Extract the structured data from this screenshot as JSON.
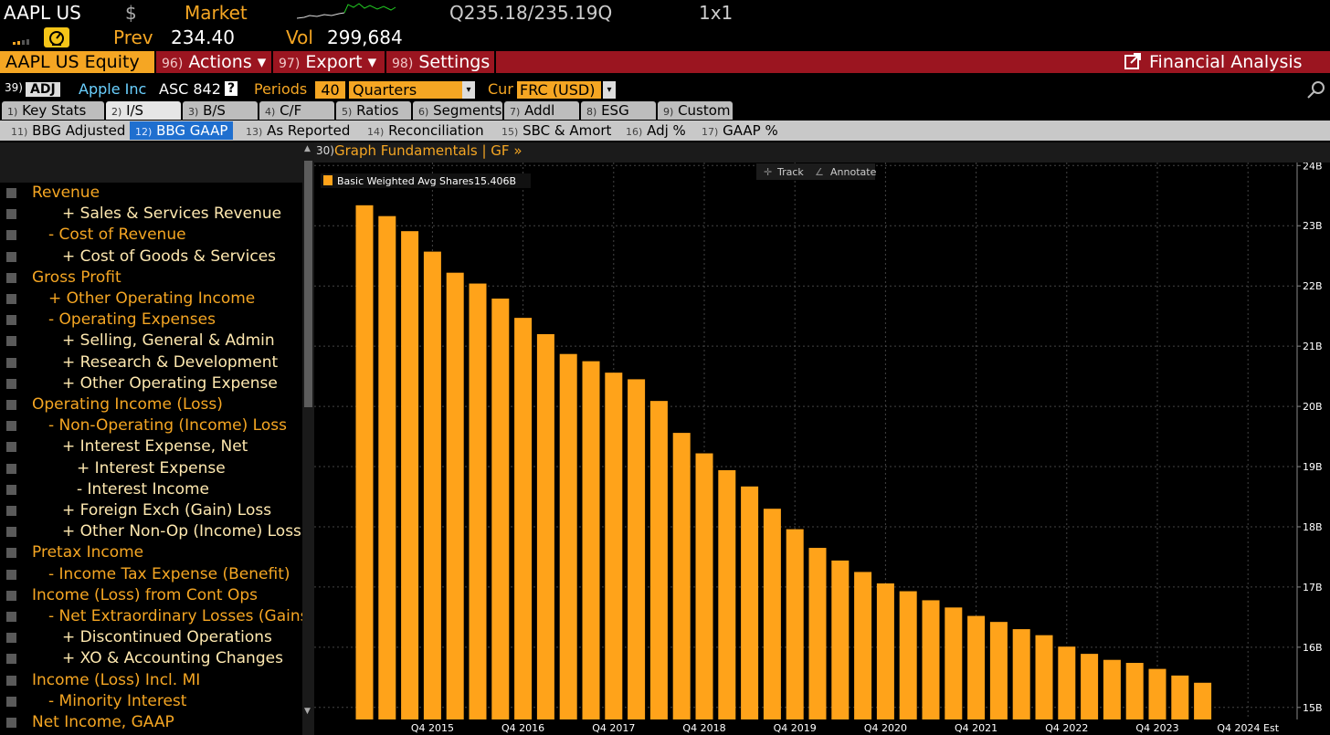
{
  "header": {
    "ticker": "AAPL US",
    "currency_symbol": "$",
    "market_label": "Market",
    "quote": "Q235.18/235.19Q",
    "size": "1x1",
    "prev_label": "Prev",
    "prev_value": "234.40",
    "vol_label": "Vol",
    "vol_value": "299,684"
  },
  "toolbar": {
    "security": "AAPL US Equity",
    "actions": {
      "num": "96)",
      "label": "Actions ▾"
    },
    "export": {
      "num": "97)",
      "label": "Export ▾"
    },
    "settings": {
      "num": "98)",
      "label": "Settings"
    },
    "financial_analysis": "Financial Analysis"
  },
  "controls": {
    "num": "39)",
    "adj": "ADJ",
    "company": "Apple Inc",
    "standard": "ASC 842",
    "help": "?",
    "periods_label": "Periods",
    "periods_value": "40",
    "periods_type": "Quarters",
    "cur_label": "Cur",
    "cur_value": "FRC (USD)"
  },
  "tabs_main": [
    {
      "num": "1)",
      "label": "Key Stats"
    },
    {
      "num": "2)",
      "label": "I/S"
    },
    {
      "num": "3)",
      "label": "B/S"
    },
    {
      "num": "4)",
      "label": "C/F"
    },
    {
      "num": "5)",
      "label": "Ratios"
    },
    {
      "num": "6)",
      "label": "Segments"
    },
    {
      "num": "7)",
      "label": "Addl"
    },
    {
      "num": "8)",
      "label": "ESG"
    },
    {
      "num": "9)",
      "label": "Custom"
    }
  ],
  "tabs_sub": [
    {
      "num": "11)",
      "label": "BBG Adjusted"
    },
    {
      "num": "12)",
      "label": "BBG GAAP"
    },
    {
      "num": "13)",
      "label": "As Reported"
    },
    {
      "num": "14)",
      "label": "Reconciliation"
    },
    {
      "num": "15)",
      "label": "SBC & Amort"
    },
    {
      "num": "16)",
      "label": "Adj %"
    },
    {
      "num": "17)",
      "label": "GAAP %"
    }
  ],
  "graph_bar": {
    "num": "30)",
    "label": "Graph Fundamentals | GF »"
  },
  "chart_tools": {
    "track": "Track",
    "annotate": "Annotate"
  },
  "line_items": [
    {
      "label": "Revenue",
      "level": 0
    },
    {
      "label": "+ Sales & Services Revenue",
      "level": 2
    },
    {
      "label": "- Cost of Revenue",
      "level": 1
    },
    {
      "label": "+ Cost of Goods & Services",
      "level": 2
    },
    {
      "label": "Gross Profit",
      "level": 0
    },
    {
      "label": "+ Other Operating Income",
      "level": 1
    },
    {
      "label": "- Operating Expenses",
      "level": 1
    },
    {
      "label": "+ Selling, General & Admin",
      "level": 2
    },
    {
      "label": "+ Research & Development",
      "level": 2
    },
    {
      "label": "+ Other Operating Expense",
      "level": 2
    },
    {
      "label": "Operating Income (Loss)",
      "level": 0
    },
    {
      "label": "- Non-Operating (Income) Loss",
      "level": 1
    },
    {
      "label": "+ Interest Expense, Net",
      "level": 2
    },
    {
      "label": "+ Interest Expense",
      "level": 3
    },
    {
      "label": "- Interest Income",
      "level": 3
    },
    {
      "label": "+ Foreign Exch (Gain) Loss",
      "level": 2
    },
    {
      "label": "+ Other Non-Op (Income) Loss",
      "level": 2
    },
    {
      "label": "Pretax Income",
      "level": 0
    },
    {
      "label": "- Income Tax Expense (Benefit)",
      "level": 1
    },
    {
      "label": "Income (Loss) from Cont Ops",
      "level": 0
    },
    {
      "label": "- Net Extraordinary Losses (Gains",
      "level": 1
    },
    {
      "label": "+ Discontinued Operations",
      "level": 2
    },
    {
      "label": "+ XO & Accounting Changes",
      "level": 2
    },
    {
      "label": "Income (Loss) Incl. MI",
      "level": 0
    },
    {
      "label": "- Minority Interest",
      "level": 1
    },
    {
      "label": "Net Income, GAAP",
      "level": 0
    }
  ],
  "colors": {
    "bar": "#ffa31a",
    "accent": "#f5a623",
    "toolbar_red": "#9b1520",
    "selected_tab": "#1f6fcf"
  },
  "chart_data": {
    "type": "bar",
    "legend": {
      "series": "Basic Weighted Avg Shares",
      "last_value": "15.406B",
      "position": "top-left"
    },
    "series": [
      {
        "name": "Basic Weighted Avg Shares",
        "values": [
          23.34,
          23.16,
          22.91,
          22.57,
          22.22,
          22.04,
          21.79,
          21.47,
          21.2,
          20.87,
          20.75,
          20.56,
          20.45,
          20.09,
          19.56,
          19.22,
          18.94,
          18.67,
          18.3,
          17.96,
          17.65,
          17.44,
          17.25,
          17.06,
          16.93,
          16.78,
          16.66,
          16.52,
          16.42,
          16.3,
          16.2,
          16.01,
          15.89,
          15.79,
          15.74,
          15.64,
          15.53,
          15.41
        ]
      }
    ],
    "x_labels": [
      "Q4 2015",
      "Q4 2016",
      "Q4 2017",
      "Q4 2018",
      "Q4 2019",
      "Q4 2020",
      "Q4 2021",
      "Q4 2022",
      "Q4 2023",
      "Q4 2024 Est"
    ],
    "y_ticks": [
      "15B",
      "16B",
      "17B",
      "18B",
      "19B",
      "20B",
      "21B",
      "22B",
      "23B",
      "24B"
    ],
    "ylim": [
      14.8,
      24.05
    ],
    "grid": true
  }
}
